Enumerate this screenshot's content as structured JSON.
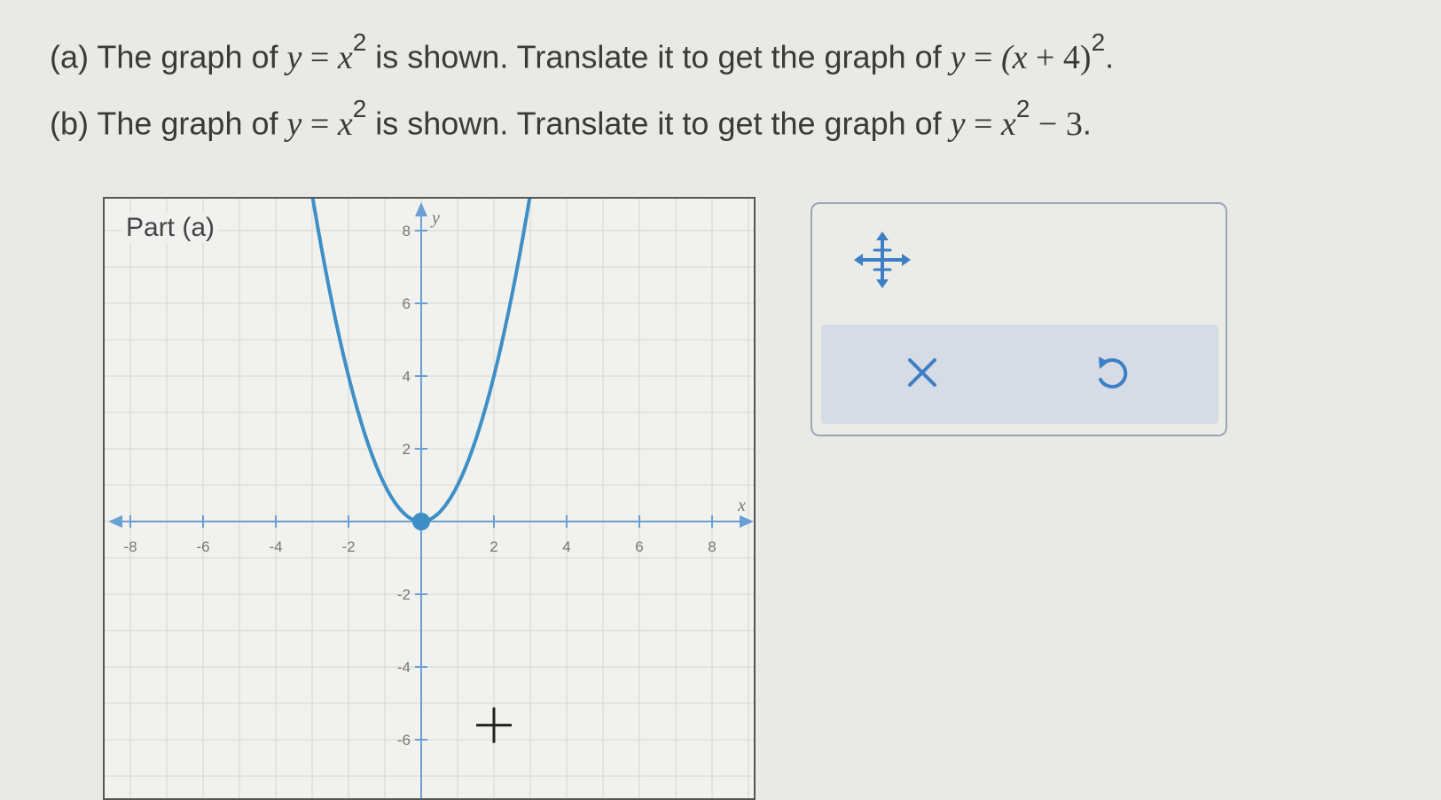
{
  "problem": {
    "part_a": {
      "prefix": "(a) The graph of ",
      "given_lhs": "y",
      "given_rhs": "x",
      "given_exp": "2",
      "middle": " is shown. Translate it to get the graph of ",
      "target_lhs": "y",
      "target_rhs_open": "(x",
      "target_plus": " + ",
      "target_num": "4)",
      "target_exp": "2",
      "suffix": "."
    },
    "part_b": {
      "prefix": "(b) The graph of ",
      "given_lhs": "y",
      "given_rhs": "x",
      "given_exp": "2",
      "middle": " is shown. Translate it to get the graph of ",
      "target_lhs": "y",
      "target_rhs": "x",
      "target_exp": "2",
      "target_tail": " − 3",
      "suffix": "."
    },
    "equals": " = "
  },
  "graph": {
    "part_label": "Part (a)",
    "x_axis_label": "x",
    "y_axis_label": "y",
    "x_ticks": [
      "-8",
      "-6",
      "-4",
      "-2",
      "2",
      "4",
      "6",
      "8"
    ],
    "y_ticks": [
      "8",
      "6",
      "4",
      "2",
      "-2",
      "-4",
      "-6"
    ],
    "curve": {
      "function": "y = x^2",
      "vertex": [
        0,
        0
      ],
      "color": "#3d8fc6"
    },
    "grid": true,
    "axis_color": "#6a9fd4"
  },
  "tools": {
    "move_icon": "move-arrows-icon",
    "clear_icon": "x-close-icon",
    "undo_icon": "undo-icon",
    "accent": "#3d7fc4"
  }
}
